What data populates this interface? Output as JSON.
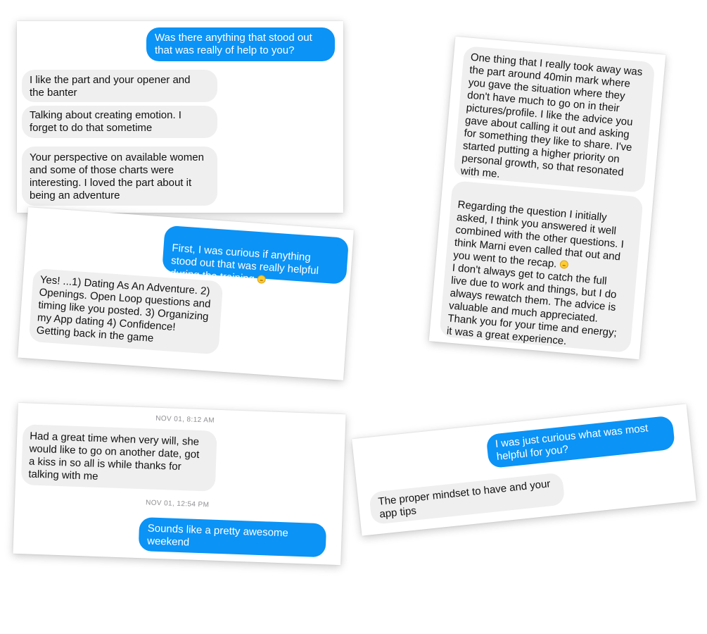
{
  "card1": {
    "msg1": "Was there anything that stood out\nthat was really of help to you?",
    "msg2": "I like the part and your opener and\nthe banter",
    "msg3": "Talking about creating emotion. I\nforget to do that sometime",
    "msg4": "Your perspective on available women\nand some of those charts were\ninteresting. I loved the part about it\nbeing an adventure"
  },
  "card2": {
    "msg1": "First, I was curious if anything\nstood out that was really helpful\nduring the training",
    "msg2": "Yes! ...1) Dating As An Adventure.  2)\nOpenings. Open Loop questions and\ntiming like you posted. 3) Organizing\nmy App dating 4) Confidence!\nGetting back in the game"
  },
  "card3": {
    "msg1": "One thing that I really took away was\nthe part around 40min mark where\nyou gave the situation where they\ndon't have much to go on in their\npictures/profile. I like the advice you\ngave about calling it out and asking\nfor something they like to share. I've\nstarted putting a higher priority on\npersonal growth, so that resonated\nwith me.",
    "msg2": "Regarding the question I initially\nasked, I think you answered it well\ncombined with the other questions. I\nthink Marni even called that out and\nyou went to the recap.",
    "msg3": "I don't always get to catch the full\nlive due to work and things, but I do\nalways rewatch them. The advice is\nvaluable and much appreciated.\nThank you for your time and energy;\nit was a great experience."
  },
  "card4": {
    "ts1": "NOV 01, 8:12 AM",
    "msg1": "Had a great time when very will,  she\nwould like to go on another date,  got\na kiss in so all is while  thanks for\ntalking with me",
    "ts2": "NOV 01, 12:54 PM",
    "msg2": "Sounds like a pretty awesome\nweekend"
  },
  "card5": {
    "msg1": "I was just curious what was most\nhelpful for you?",
    "msg2": "The proper mindset to have and your\napp tips"
  },
  "colors": {
    "incoming_bubble": "#efefef",
    "outgoing_bubble": "#0b93f6",
    "timestamp": "#8e8e93",
    "emoji": "smiling-face-icon"
  }
}
